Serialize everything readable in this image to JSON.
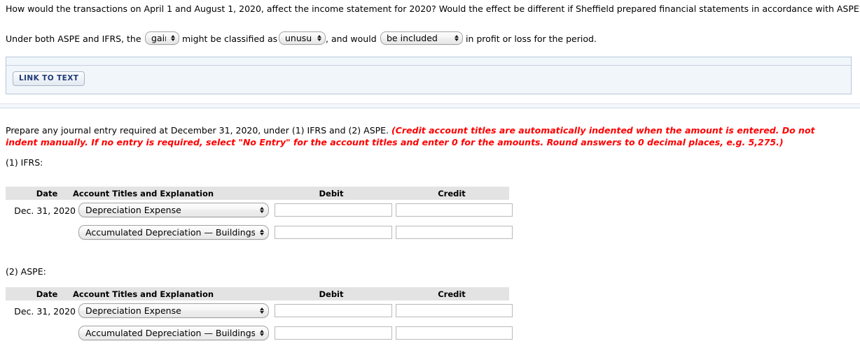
{
  "question": {
    "prompt": "How would the transactions on April 1 and August 1, 2020, affect the income statement for 2020? Would the effect be different if Sheffield prepared financial statements in accordance with ASPE?",
    "answer_sentence": {
      "part1": "Under both ASPE and IFRS, the",
      "select_gain": "gain",
      "part2": "might be classified as",
      "select_unusual": "unusual",
      "part3": ", and would",
      "select_included": "be included",
      "part4": "in profit or loss for the period."
    }
  },
  "link_panel": {
    "button_label": "LINK TO TEXT"
  },
  "instructions": {
    "normal": "Prepare any journal entry required at December 31, 2020, under (1) IFRS and (2) ASPE. ",
    "emphasis": "(Credit account titles are automatically indented when the amount is entered. Do not indent manually. If no entry is required, select \"No Entry\" for the account titles and enter 0 for the amounts. Round answers to 0 decimal places, e.g. 5,275.)"
  },
  "columns": {
    "date": "Date",
    "account": "Account Titles and Explanation",
    "debit": "Debit",
    "credit": "Credit"
  },
  "sections": [
    {
      "label": "(1) IFRS:",
      "rows": [
        {
          "date": "Dec. 31, 2020",
          "account": "Depreciation Expense",
          "debit": "",
          "credit": ""
        },
        {
          "date": "",
          "account": "Accumulated Depreciation — Buildings",
          "debit": "",
          "credit": ""
        }
      ]
    },
    {
      "label": "(2) ASPE:",
      "rows": [
        {
          "date": "Dec. 31, 2020",
          "account": "Depreciation Expense",
          "debit": "",
          "credit": ""
        },
        {
          "date": "",
          "account": "Accumulated Depreciation — Buildings",
          "debit": "",
          "credit": ""
        }
      ]
    }
  ],
  "colors": {
    "header_bg": "#e3e3e3",
    "panel_bg": "#f1f6fb",
    "panel_border": "#b7c6d8",
    "link_text": "#203a77",
    "emphasis_red": "#ff0000"
  }
}
